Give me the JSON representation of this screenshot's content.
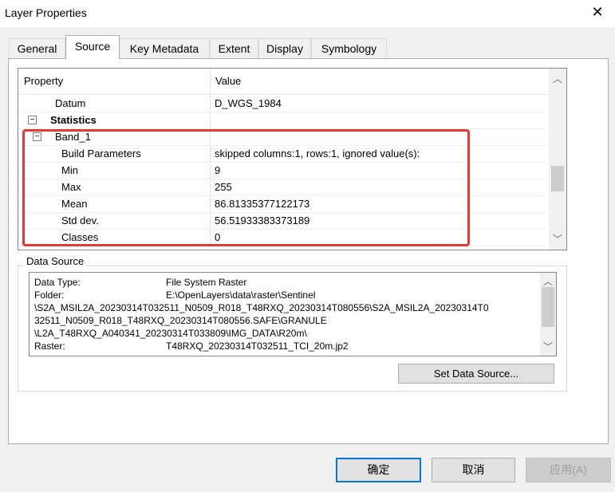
{
  "window": {
    "title": "Layer Properties"
  },
  "tabs": [
    "General",
    "Source",
    "Key Metadata",
    "Extent",
    "Display",
    "Symbology"
  ],
  "active_tab": "Source",
  "grid": {
    "headers": {
      "property": "Property",
      "value": "Value"
    },
    "rows": [
      {
        "property": "Datum",
        "value": "D_WGS_1984"
      },
      {
        "property": "Statistics",
        "value": "",
        "expander": "−"
      },
      {
        "property": "Band_1",
        "value": "",
        "expander": "−"
      },
      {
        "property": "Build Parameters",
        "value": "skipped columns:1, rows:1, ignored value(s):"
      },
      {
        "property": "Min",
        "value": "9"
      },
      {
        "property": "Max",
        "value": "255"
      },
      {
        "property": "Mean",
        "value": "86.81335377122173"
      },
      {
        "property": "Std dev.",
        "value": "56.51933383373189"
      },
      {
        "property": "Classes",
        "value": "0"
      }
    ]
  },
  "data_source": {
    "label": "Data Source",
    "lines": [
      {
        "key": "Data Type:",
        "value": "File System Raster"
      },
      {
        "key": "Folder:",
        "value": "E:\\OpenLayers\\data\\raster\\Sentinel"
      },
      {
        "key": "\\S2A_MSIL2A_20230314T032511_N0509_R018_T48RXQ_20230314T080556\\S2A_MSIL2A_20230314T0",
        "value": ""
      },
      {
        "key": "32511_N0509_R018_T48RXQ_20230314T080556.SAFE\\GRANULE",
        "value": ""
      },
      {
        "key": "\\L2A_T48RXQ_A040341_20230314T033809\\IMG_DATA\\R20m\\",
        "value": ""
      },
      {
        "key": "Raster:",
        "value": "T48RXQ_20230314T032511_TCI_20m.jp2"
      }
    ],
    "set_button": "Set Data Source..."
  },
  "buttons": {
    "ok": "确定",
    "cancel": "取消",
    "apply": "应用(A)"
  },
  "colors": {
    "highlight": "#e53935",
    "primary_border": "#0078d7"
  }
}
